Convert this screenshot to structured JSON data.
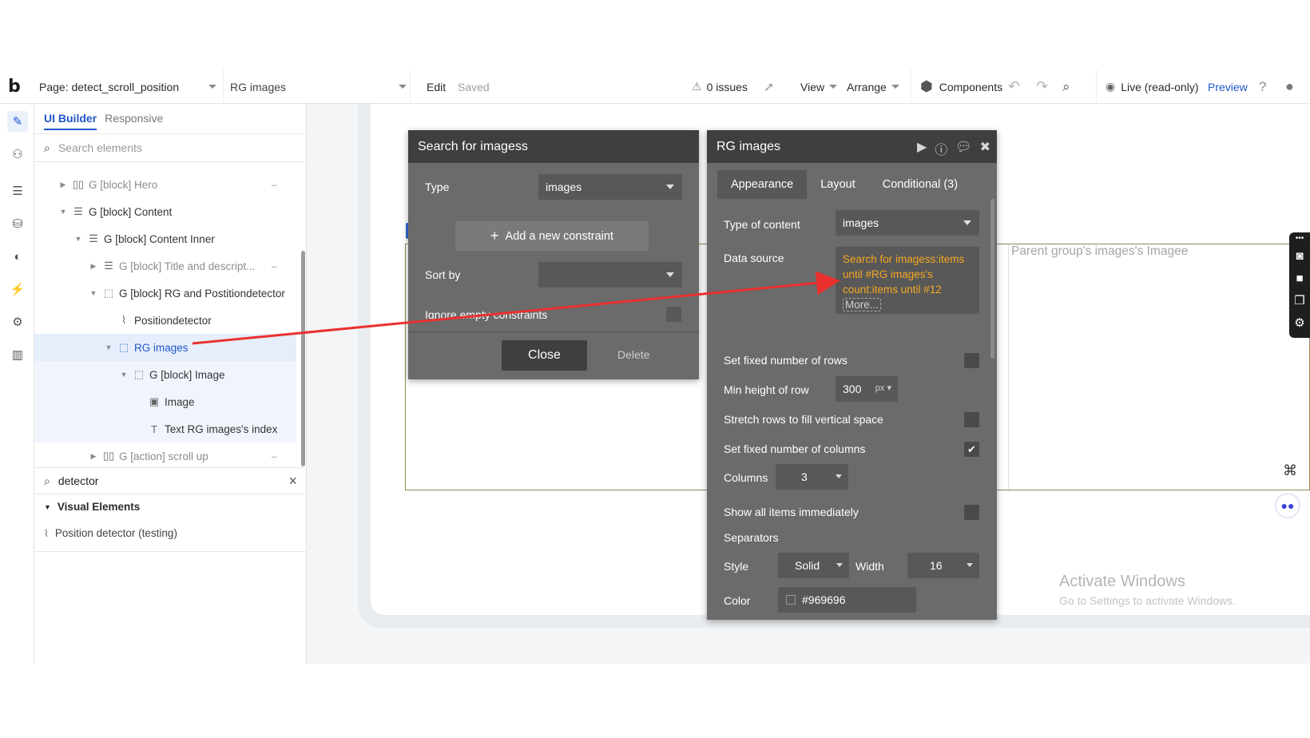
{
  "topbar": {
    "logo": "b",
    "page_label": "Page: detect_scroll_position",
    "element_select": "RG images",
    "edit": "Edit",
    "saved": "Saved",
    "issues": "0 issues",
    "view": "View",
    "arrange": "Arrange",
    "components": "Components",
    "live": "Live (read-only)",
    "preview": "Preview"
  },
  "panel": {
    "tab_ui_builder": "UI Builder",
    "tab_responsive": "Responsive",
    "search_placeholder": "Search elements",
    "tree": [
      {
        "label": "G [block] Hero",
        "depth": 0,
        "arrow": "right",
        "icon": "columns",
        "hidden": true,
        "muted": true
      },
      {
        "label": "G [block] Content",
        "depth": 0,
        "arrow": "down",
        "icon": "rows",
        "hidden": false,
        "muted": false
      },
      {
        "label": "G [block] Content Inner",
        "depth": 1,
        "arrow": "down",
        "icon": "rows",
        "hidden": false,
        "muted": false
      },
      {
        "label": "G [block] Title and descript...",
        "depth": 2,
        "arrow": "right",
        "icon": "rows",
        "hidden": true,
        "muted": true
      },
      {
        "label": "G [block] RG and Postitiondetector",
        "depth": 2,
        "arrow": "down",
        "icon": "dashed",
        "hidden": false,
        "muted": false
      },
      {
        "label": "Positiondetector",
        "depth": 3,
        "arrow": "",
        "icon": "rss",
        "hidden": false,
        "muted": false
      },
      {
        "label": "RG images",
        "depth": 3,
        "arrow": "down",
        "icon": "dashed",
        "hidden": false,
        "muted": false
      },
      {
        "label": "G [block] Image",
        "depth": 4,
        "arrow": "down",
        "icon": "dashed",
        "hidden": false,
        "muted": false
      },
      {
        "label": "Image",
        "depth": 5,
        "arrow": "",
        "icon": "image",
        "hidden": false,
        "muted": false
      },
      {
        "label": "Text RG images's index",
        "depth": 5,
        "arrow": "",
        "icon": "text",
        "hidden": false,
        "muted": false
      },
      {
        "label": "G [action] scroll up",
        "depth": 2,
        "arrow": "right",
        "icon": "columns",
        "hidden": true,
        "muted": true
      }
    ],
    "filter_value": "detector",
    "visual_heading": "Visual Elements",
    "visual_item": "Position detector (testing)"
  },
  "canvas": {
    "parent_text": "Parent group's images's Imagee",
    "activate_title": "Activate Windows",
    "activate_sub": "Go to Settings to activate Windows."
  },
  "search_popup": {
    "title": "Search for imagess",
    "type_label": "Type",
    "type_value": "images",
    "add_constraint": "Add a new constraint",
    "sort_label": "Sort by",
    "sort_value": "",
    "ignore_label": "Ignore empty constraints",
    "close": "Close",
    "delete": "Delete"
  },
  "rg_popup": {
    "title": "RG images",
    "tabs": [
      "Appearance",
      "Layout",
      "Conditional (3)"
    ],
    "type_content_label": "Type of content",
    "type_content_value": "images",
    "data_source_label": "Data source",
    "data_source_value": "Search for imagess:items until #RG images's count:items until #12",
    "more": "More...",
    "fixed_rows_label": "Set fixed number of rows",
    "min_height_label": "Min height of row",
    "min_height_value": "300",
    "min_height_unit": "px",
    "stretch_label": "Stretch rows to fill vertical space",
    "fixed_cols_label": "Set fixed number of columns",
    "fixed_cols_checked": true,
    "columns_label": "Columns",
    "columns_value": "3",
    "show_all_label": "Show all items immediately",
    "separators_label": "Separators",
    "style_label": "Style",
    "style_value": "Solid",
    "width_label": "Width",
    "width_value": "16",
    "color_label": "Color",
    "color_value": "#969696"
  },
  "colors": {
    "accent": "#2057c9",
    "arrow": "#e8312f",
    "data_source_text": "#f5a623"
  }
}
